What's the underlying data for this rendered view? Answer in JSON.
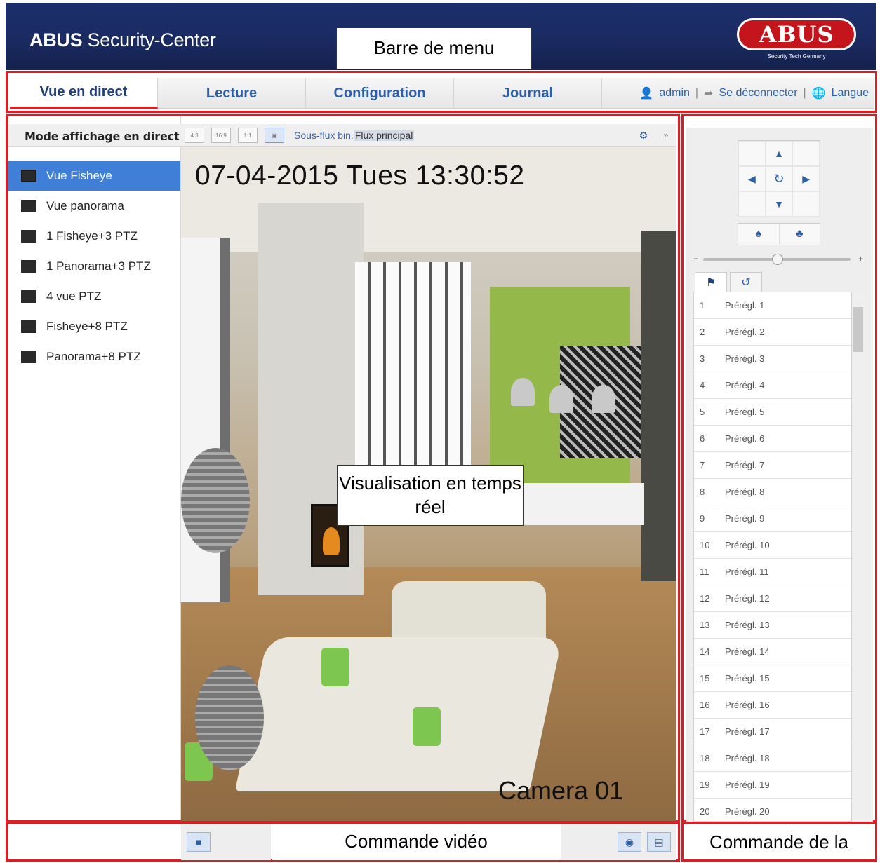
{
  "header": {
    "brand_bold": "ABUS",
    "brand_rest": " Security-Center",
    "logo_text": "ABUS",
    "logo_tagline": "Security Tech Germany"
  },
  "callouts": {
    "menu_bar": "Barre de menu",
    "live_view": "Visualisation en temps réel",
    "video_control": "Commande vidéo",
    "ptz_control": "Commande de la"
  },
  "nav": {
    "tabs": [
      {
        "label": "Vue en direct",
        "active": true
      },
      {
        "label": "Lecture",
        "active": false
      },
      {
        "label": "Configuration",
        "active": false
      },
      {
        "label": "Journal",
        "active": false
      }
    ],
    "user": "admin",
    "logout": "Se déconnecter",
    "language": "Langue"
  },
  "toolbar": {
    "mode_label": "Mode affichage en direct",
    "stream_sub": "Sous-flux bin.",
    "stream_main": "Flux principal"
  },
  "modes": [
    {
      "label": "Vue Fisheye",
      "active": true
    },
    {
      "label": "Vue panorama",
      "active": false
    },
    {
      "label": "1 Fisheye+3 PTZ",
      "active": false
    },
    {
      "label": "1 Panorama+3 PTZ",
      "active": false
    },
    {
      "label": "4 vue PTZ",
      "active": false
    },
    {
      "label": "Fisheye+8 PTZ",
      "active": false
    },
    {
      "label": "Panorama+8 PTZ",
      "active": false
    }
  ],
  "video": {
    "timestamp": "07-04-2015  Tues  13:30:52",
    "camera_name": "Camera 01"
  },
  "ptz": {
    "presets": [
      {
        "num": "1",
        "label": "Prérégl. 1"
      },
      {
        "num": "2",
        "label": "Prérégl. 2"
      },
      {
        "num": "3",
        "label": "Prérégl. 3"
      },
      {
        "num": "4",
        "label": "Prérégl. 4"
      },
      {
        "num": "5",
        "label": "Prérégl. 5"
      },
      {
        "num": "6",
        "label": "Prérégl. 6"
      },
      {
        "num": "7",
        "label": "Prérégl. 7"
      },
      {
        "num": "8",
        "label": "Prérégl. 8"
      },
      {
        "num": "9",
        "label": "Prérégl. 9"
      },
      {
        "num": "10",
        "label": "Prérégl. 10"
      },
      {
        "num": "11",
        "label": "Prérégl. 11"
      },
      {
        "num": "12",
        "label": "Prérégl. 12"
      },
      {
        "num": "13",
        "label": "Prérégl. 13"
      },
      {
        "num": "14",
        "label": "Prérégl. 14"
      },
      {
        "num": "15",
        "label": "Prérégl. 15"
      },
      {
        "num": "16",
        "label": "Prérégl. 16"
      },
      {
        "num": "17",
        "label": "Prérégl. 17"
      },
      {
        "num": "18",
        "label": "Prérégl. 18"
      },
      {
        "num": "19",
        "label": "Prérégl. 19"
      },
      {
        "num": "20",
        "label": "Prérégl. 20"
      }
    ]
  },
  "colors": {
    "accent_red": "#e01b22",
    "header_blue": "#1c2f6c",
    "link_blue": "#2c5fa8",
    "selected_blue": "#3f7fd8"
  }
}
